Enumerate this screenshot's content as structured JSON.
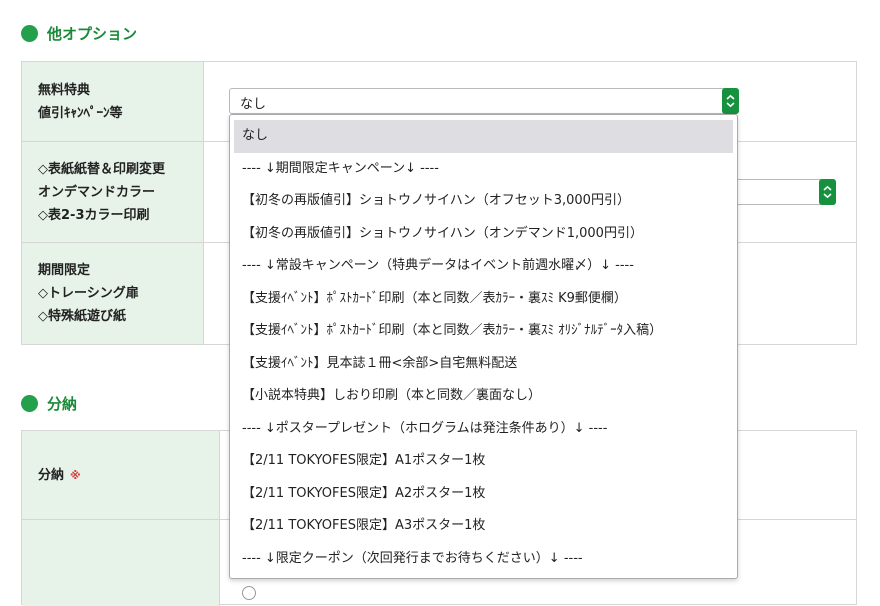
{
  "sections": {
    "options": {
      "title": "他オプション"
    },
    "bunno": {
      "title": "分納"
    }
  },
  "options_table": {
    "rows": [
      {
        "label_lines": [
          "無料特典",
          "値引ｷｬﾝﾍﾟｰﾝ等"
        ],
        "select_value": "なし"
      },
      {
        "label_lines": [
          "◇表紙紙替＆印刷変更",
          "オンデマンドカラー",
          "◇表2-3カラー印刷"
        ]
      },
      {
        "label_lines": [
          "期間限定",
          "◇トレーシング扉",
          "◇特殊紙遊び紙"
        ]
      }
    ]
  },
  "bunno_table": {
    "rows": [
      {
        "label": "分納",
        "required_mark": "※"
      },
      {
        "label": ""
      }
    ]
  },
  "dropdown": {
    "selected_index": 0,
    "options": [
      "なし",
      "---- ↓期間限定キャンペーン↓ ----",
      "【初冬の再版値引】ショトウノサイハン（オフセット3,000円引）",
      "【初冬の再版値引】ショトウノサイハン（オンデマンド1,000円引）",
      "---- ↓常設キャンペーン（特典データはイベント前週水曜〆）↓ ----",
      "【支援ｲﾍﾞﾝﾄ】ﾎﾟｽﾄｶｰﾄﾞ印刷（本と同数／表ｶﾗｰ・裏ｽﾐ K9郵便欄）",
      "【支援ｲﾍﾞﾝﾄ】ﾎﾟｽﾄｶｰﾄﾞ印刷（本と同数／表ｶﾗｰ・裏ｽﾐ ｵﾘｼﾞﾅﾙﾃﾞｰﾀ入稿）",
      "【支援ｲﾍﾞﾝﾄ】見本誌１冊<余部>自宅無料配送",
      "【小説本特典】しおり印刷（本と同数／裏面なし）",
      "---- ↓ポスタープレゼント（ホログラムは発注条件あり）↓ ----",
      "【2/11 TOKYOFES限定】A1ポスター1枚",
      "【2/11 TOKYOFES限定】A2ポスター1枚",
      "【2/11 TOKYOFES限定】A3ポスター1枚",
      "---- ↓限定クーポン（次回発行までお待ちください）↓ ----"
    ]
  },
  "colors": {
    "accent_green": "#22a04b",
    "header_bg": "#e7f3e9",
    "selected_bg": "#dedee2"
  }
}
